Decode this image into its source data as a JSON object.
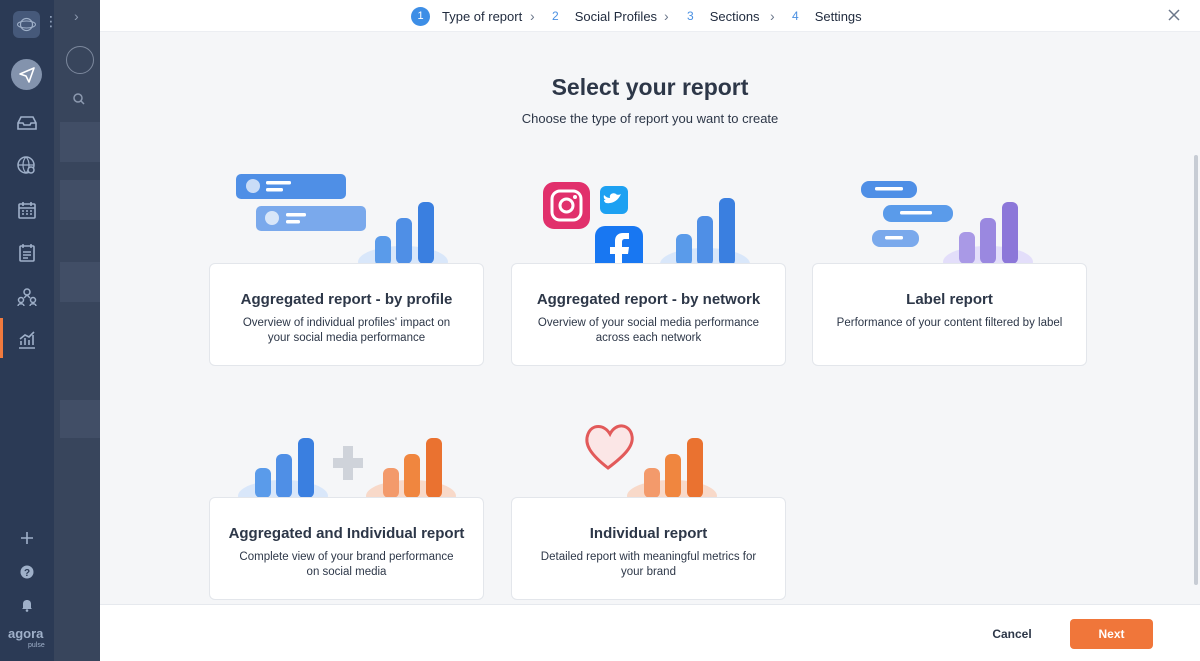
{
  "nav": {
    "items": [
      {
        "icon": "publish-icon"
      },
      {
        "icon": "inbox-icon"
      },
      {
        "icon": "listening-icon"
      },
      {
        "icon": "calendar-icon"
      },
      {
        "icon": "planner-icon"
      },
      {
        "icon": "team-icon"
      },
      {
        "icon": "reports-icon"
      }
    ],
    "bottom": [
      {
        "icon": "plus-icon"
      },
      {
        "icon": "help-icon"
      },
      {
        "icon": "bell-icon"
      }
    ],
    "brand": "agora",
    "brand_sub": "pulse"
  },
  "steps": [
    {
      "num": "1",
      "label": "Type of report",
      "active": true
    },
    {
      "num": "2",
      "label": "Social Profiles"
    },
    {
      "num": "3",
      "label": "Sections"
    },
    {
      "num": "4",
      "label": "Settings"
    }
  ],
  "page": {
    "title": "Select your report",
    "subtitle": "Choose the type of report you want to create"
  },
  "reports": [
    {
      "title": "Aggregated report - by profile",
      "description": "Overview of individual profiles' impact on your social media performance"
    },
    {
      "title": "Aggregated report - by network",
      "description": "Overview of your social media performance across each network"
    },
    {
      "title": "Label report",
      "description": "Performance of your content filtered by label"
    },
    {
      "title": "Aggregated and Individual report",
      "description": "Complete view of your brand performance on social media"
    },
    {
      "title": "Individual report",
      "description": "Detailed report with meaningful metrics for your brand"
    }
  ],
  "footer": {
    "cancel_label": "Cancel",
    "next_label": "Next"
  },
  "colors": {
    "accent": "#f0763a",
    "step_active": "#3d8ee6",
    "nav_bg": "#2b3a55"
  }
}
